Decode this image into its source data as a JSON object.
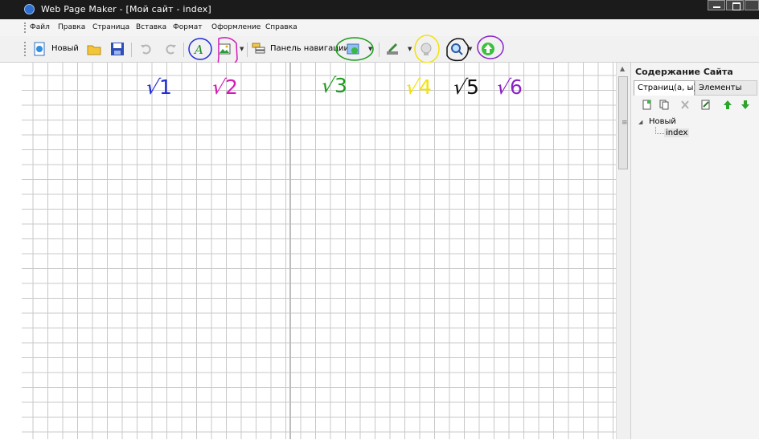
{
  "window": {
    "title": "Web Page Maker - [Мой сайт - index]"
  },
  "menu": {
    "items": [
      "Файл",
      "Правка",
      "Страница",
      "Вставка",
      "Формат",
      "Оформление",
      "Справка"
    ]
  },
  "toolbar": {
    "new_label": "Новый",
    "nav_panel_label": "Панель навигации"
  },
  "annotations": {
    "n1": "1",
    "n2": "2",
    "n3": "3",
    "n4": "4",
    "n5": "5",
    "n6": "6",
    "colors": {
      "n1": "#1f2bd8",
      "n2": "#d21bb6",
      "n3": "#1e9a1e",
      "n4": "#f2e20a",
      "n5": "#111111",
      "n6": "#8b22c8"
    }
  },
  "sidebar": {
    "title": "Содержание Сайта",
    "tab_pages": "Страниц(а, ы)",
    "tab_elements": "Элементы",
    "tree": {
      "root": "Новый",
      "child": "index"
    }
  }
}
